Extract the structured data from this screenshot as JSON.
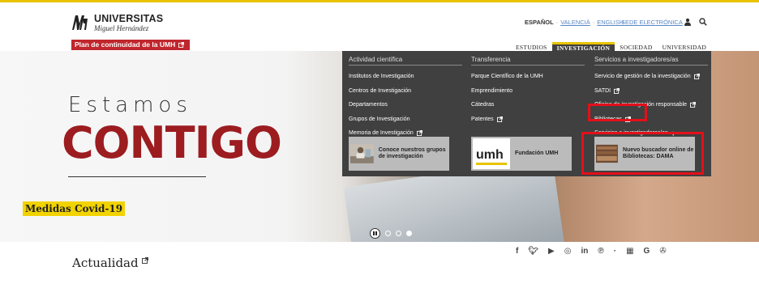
{
  "header": {
    "logo_title": "UNIVERSITAS",
    "logo_subtitle": "Miguel Hernández",
    "plan_label": "Plan de continuidad de la UMH",
    "languages": [
      "ESPAÑOL",
      "VALENCIÀ",
      "ENGLISH"
    ],
    "sede_label": "SEDE ELECTRÓNICA",
    "nav": [
      "ESTUDIOS",
      "INVESTIGACIÓN",
      "SOCIEDAD",
      "UNIVERSIDAD"
    ],
    "active_nav": "INVESTIGACIÓN"
  },
  "hero": {
    "line1": "Estamos",
    "line2": "CONTIGO",
    "covid_label": "Medidas Covid-19"
  },
  "menu": {
    "col1": {
      "title": "Actividad científica",
      "items": [
        "Institutos de Investigación",
        "Centros de Investigación",
        "Departamentos",
        "Grupos de Investigación",
        "Memoria de Investigación"
      ],
      "promo": "Conoce nuestros grupos de investigación"
    },
    "col2": {
      "title": "Transferencia",
      "items": [
        "Parque Científico de la UMH",
        "Emprendimiento",
        "Cátedras",
        "Patentes"
      ],
      "promo": "Fundación UMH",
      "promo_logo": "umh"
    },
    "col3": {
      "title": "Servicios a investigadores/as",
      "items": [
        "Servicio de gestión de la investigación",
        "SATDI",
        "Oficina de investigación responsable",
        "Bibliotecas",
        "Servicios a investigadores/as"
      ],
      "promo": "Nuevo buscador online de Bibliotecas: DAMA"
    }
  },
  "bottom": {
    "actualidad": "Actualidad",
    "social_icons": [
      "facebook-icon",
      "twitter-icon",
      "youtube-icon",
      "instagram-icon",
      "linkedin-icon",
      "pinterest-icon",
      "separator",
      "windows-icon",
      "google-icon",
      "android-icon",
      "apple-icon"
    ]
  },
  "colors": {
    "brand_red": "#c0262d",
    "accent_yellow": "#e8c400",
    "menu_bg": "#404040",
    "highlight_red": "#e3101a"
  }
}
